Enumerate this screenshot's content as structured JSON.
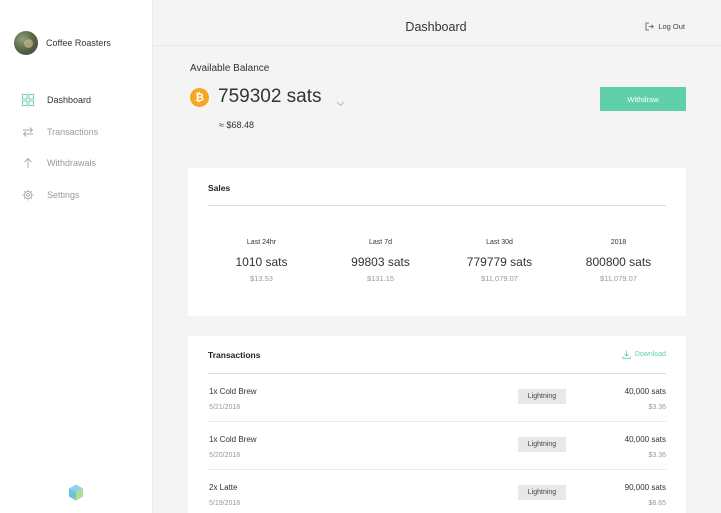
{
  "profile": {
    "name": "Coffee Roasters"
  },
  "sidebar": {
    "items": [
      {
        "label": "Dashboard",
        "icon": "grid-icon"
      },
      {
        "label": "Transactions",
        "icon": "swap-arrows-icon"
      },
      {
        "label": "Withdrawals",
        "icon": "arrow-up-icon"
      },
      {
        "label": "Settings",
        "icon": "gear-icon"
      }
    ]
  },
  "header": {
    "title": "Dashboard",
    "logout_label": "Log Out"
  },
  "balance": {
    "label": "Available Balance",
    "amount": "759302 sats",
    "fiat": "≈ $68.48",
    "currency_icon": "bitcoin-icon",
    "withdraw_label": "Withdraw"
  },
  "sales": {
    "title": "Sales",
    "stats": [
      {
        "period": "Last 24hr",
        "sats": "1010 sats",
        "fiat": "$13.53"
      },
      {
        "period": "Last 7d",
        "sats": "99803 sats",
        "fiat": "$131.15"
      },
      {
        "period": "Last 30d",
        "sats": "779779 sats",
        "fiat": "$11,079.07"
      },
      {
        "period": "2018",
        "sats": "800800 sats",
        "fiat": "$11,079.07"
      }
    ]
  },
  "transactions": {
    "title": "Transactions",
    "download_label": "Download",
    "rows": [
      {
        "description": "1x Cold Brew",
        "date": "5/21/2018",
        "method": "Lightning",
        "sats": "40,000 sats",
        "fiat": "$3.36"
      },
      {
        "description": "1x Cold Brew",
        "date": "5/20/2018",
        "method": "Lightning",
        "sats": "40,000 sats",
        "fiat": "$3.36"
      },
      {
        "description": "2x Latte",
        "date": "5/19/2018",
        "method": "Lightning",
        "sats": "90,000 sats",
        "fiat": "$8.65"
      }
    ]
  },
  "colors": {
    "accent": "#5fd0aa",
    "bitcoin": "#f6a623",
    "background": "#f4f4f4",
    "badge": "#e8e8e8"
  }
}
